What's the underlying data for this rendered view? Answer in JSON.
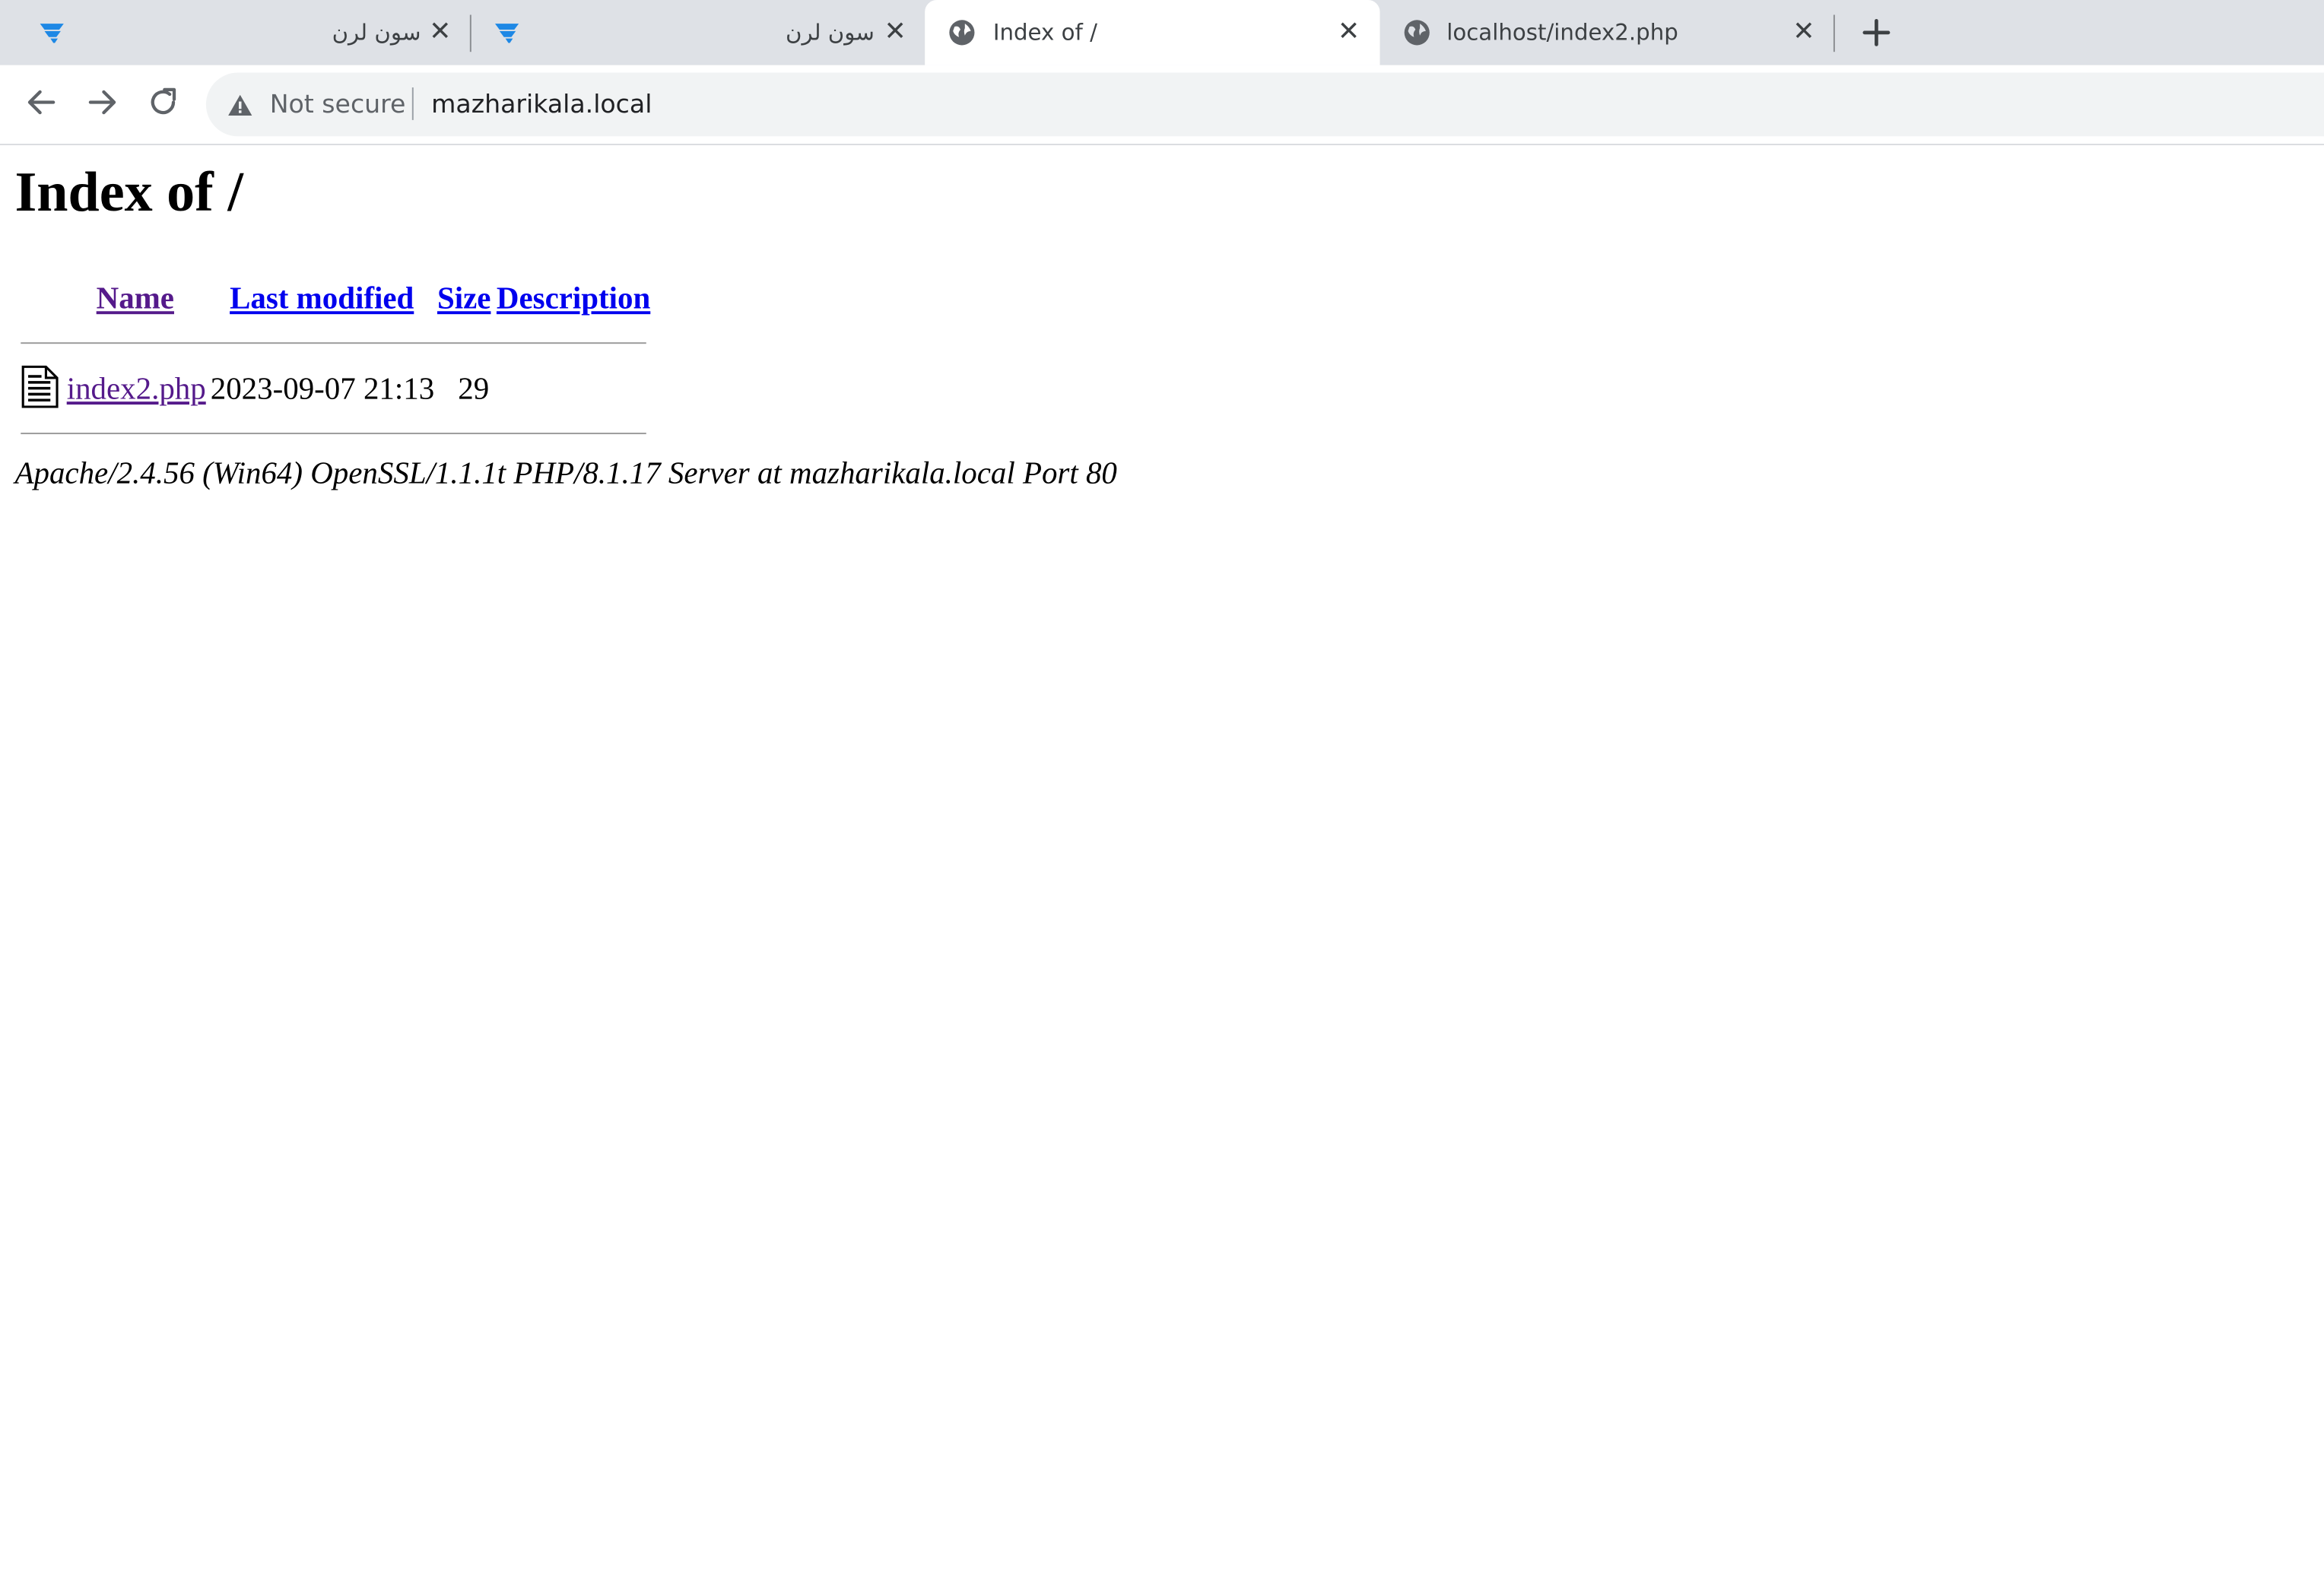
{
  "tabs": [
    {
      "title": "سون لرن",
      "favicon": "sevenlearn-logo-icon",
      "close": "✕"
    },
    {
      "title": "سون لرن",
      "favicon": "sevenlearn-logo-icon",
      "close": "✕"
    },
    {
      "title": "Index of /",
      "favicon": "globe-icon",
      "close": "✕"
    },
    {
      "title": "localhost/index2.php",
      "favicon": "globe-icon",
      "close": "✕"
    }
  ],
  "toolbar": {
    "security_label": "Not secure",
    "url": "mazharikala.local"
  },
  "page": {
    "heading": "Index of /",
    "columns": {
      "name": "Name",
      "last_modified": "Last modified",
      "size": "Size",
      "description": "Description"
    },
    "rows": [
      {
        "icon": "text-file-icon",
        "name": "index2.php",
        "last_modified": "2023-09-07 21:13",
        "size": "29",
        "description": ""
      }
    ],
    "footer": "Apache/2.4.56 (Win64) OpenSSL/1.1.1t PHP/8.1.17 Server at mazharikala.local Port 80"
  },
  "colors": {
    "tabstrip_bg": "#dee1e6",
    "link": "#0000ee",
    "visited_link": "#551a8b",
    "brand_blue": "#1e88e5"
  }
}
